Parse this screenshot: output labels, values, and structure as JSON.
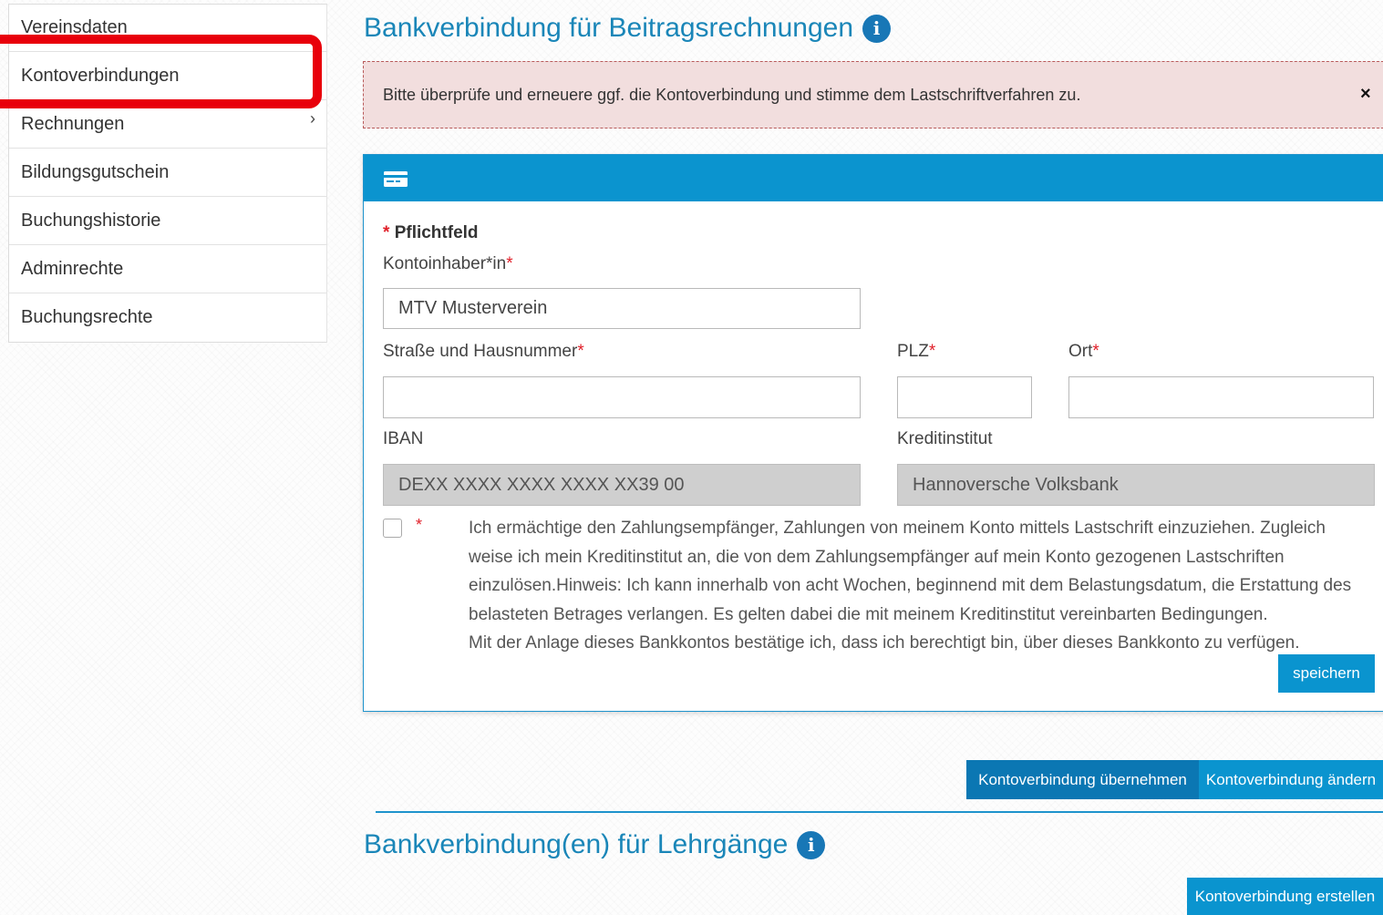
{
  "sidebar": {
    "items": [
      {
        "label": "Vereinsdaten"
      },
      {
        "label": "Kontoverbindungen"
      },
      {
        "label": "Rechnungen"
      },
      {
        "label": "Bildungsgutschein"
      },
      {
        "label": "Buchungshistorie"
      },
      {
        "label": "Adminrechte"
      },
      {
        "label": "Buchungsrechte"
      }
    ]
  },
  "section1": {
    "title": "Bankverbindung für Beitragsrechnungen",
    "info_glyph": "i"
  },
  "alert": {
    "text": "Bitte überprüfe und erneuere ggf. die Kontoverbindung und stimme dem Lastschriftverfahren zu.",
    "close": "×"
  },
  "form": {
    "required_note_star": "*",
    "required_note_text": "Pflichtfeld",
    "account_holder_label": "Kontoinhaber*in",
    "account_holder_value": "MTV Musterverein",
    "street_label": "Straße und Hausnummer",
    "street_value": "",
    "zip_label": "PLZ",
    "zip_value": "",
    "city_label": "Ort",
    "city_value": "",
    "iban_label": "IBAN",
    "iban_value": "DEXX XXXX XXXX XXXX XX39 00",
    "bank_label": "Kreditinstitut",
    "bank_value": "Hannoversche Volksbank",
    "required_star": "*",
    "consent_text": "Ich ermächtige den Zahlungsempfänger, Zahlungen von meinem Konto mittels Lastschrift einzuziehen. Zugleich weise ich mein Kreditinstitut an, die von dem Zahlungsempfänger auf mein Konto gezogenen Lastschriften einzulösen.Hinweis: Ich kann innerhalb von acht Wochen, beginnend mit dem Belastungsdatum, die Erstattung des belasteten Betrages verlangen. Es gelten dabei die mit meinem Kreditinstitut vereinbarten Bedingungen.",
    "consent_text_2": "Mit der Anlage dieses Bankkontos bestätige ich, dass ich berechtigt bin, über dieses Bankkonto zu verfügen.",
    "save_label": "speichern"
  },
  "actions": {
    "adopt_label": "Kontoverbindung übernehmen",
    "change_label": "Kontoverbindung ändern"
  },
  "section2": {
    "title": "Bankverbindung(en) für Lehrgänge",
    "info_glyph": "i",
    "create_label": "Kontoverbindung erstellen"
  },
  "colors": {
    "accent": "#0a94cf",
    "heading": "#1a86b8",
    "alert_bg": "#f2dede",
    "highlight": "#e8000b",
    "required": "#e0202a"
  }
}
